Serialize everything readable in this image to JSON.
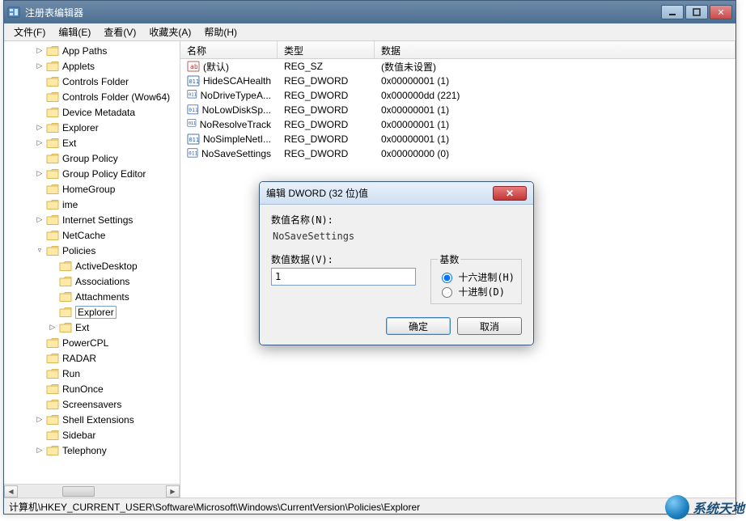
{
  "window": {
    "title": "注册表编辑器"
  },
  "menu": {
    "file": "文件(F)",
    "edit": "编辑(E)",
    "view": "查看(V)",
    "favorites": "收藏夹(A)",
    "help": "帮助(H)"
  },
  "tree": {
    "items": [
      {
        "exp": "▷",
        "label": "App Paths",
        "indent": 2
      },
      {
        "exp": "▷",
        "label": "Applets",
        "indent": 2
      },
      {
        "exp": "",
        "label": "Controls Folder",
        "indent": 2
      },
      {
        "exp": "",
        "label": "Controls Folder (Wow64)",
        "indent": 2
      },
      {
        "exp": "",
        "label": "Device Metadata",
        "indent": 2
      },
      {
        "exp": "▷",
        "label": "Explorer",
        "indent": 2
      },
      {
        "exp": "▷",
        "label": "Ext",
        "indent": 2
      },
      {
        "exp": "",
        "label": "Group Policy",
        "indent": 2
      },
      {
        "exp": "▷",
        "label": "Group Policy Editor",
        "indent": 2
      },
      {
        "exp": "",
        "label": "HomeGroup",
        "indent": 2
      },
      {
        "exp": "",
        "label": "ime",
        "indent": 2
      },
      {
        "exp": "▷",
        "label": "Internet Settings",
        "indent": 2
      },
      {
        "exp": "",
        "label": "NetCache",
        "indent": 2
      },
      {
        "exp": "▿",
        "label": "Policies",
        "indent": 2
      },
      {
        "exp": "",
        "label": "ActiveDesktop",
        "indent": 3
      },
      {
        "exp": "",
        "label": "Associations",
        "indent": 3
      },
      {
        "exp": "",
        "label": "Attachments",
        "indent": 3
      },
      {
        "exp": "",
        "label": "Explorer",
        "indent": 3,
        "selected": true
      },
      {
        "exp": "▷",
        "label": "Ext",
        "indent": 3
      },
      {
        "exp": "",
        "label": "PowerCPL",
        "indent": 2
      },
      {
        "exp": "",
        "label": "RADAR",
        "indent": 2
      },
      {
        "exp": "",
        "label": "Run",
        "indent": 2
      },
      {
        "exp": "",
        "label": "RunOnce",
        "indent": 2
      },
      {
        "exp": "",
        "label": "Screensavers",
        "indent": 2
      },
      {
        "exp": "▷",
        "label": "Shell Extensions",
        "indent": 2
      },
      {
        "exp": "",
        "label": "Sidebar",
        "indent": 2
      },
      {
        "exp": "▷",
        "label": "Telephony",
        "indent": 2
      }
    ]
  },
  "list": {
    "headers": {
      "name": "名称",
      "type": "类型",
      "data": "数据"
    },
    "rows": [
      {
        "icon": "sz",
        "name": "(默认)",
        "type": "REG_SZ",
        "data": "(数值未设置)"
      },
      {
        "icon": "dw",
        "name": "HideSCAHealth",
        "type": "REG_DWORD",
        "data": "0x00000001 (1)"
      },
      {
        "icon": "dw",
        "name": "NoDriveTypeA...",
        "type": "REG_DWORD",
        "data": "0x000000dd (221)"
      },
      {
        "icon": "dw",
        "name": "NoLowDiskSp...",
        "type": "REG_DWORD",
        "data": "0x00000001 (1)"
      },
      {
        "icon": "dw",
        "name": "NoResolveTrack",
        "type": "REG_DWORD",
        "data": "0x00000001 (1)"
      },
      {
        "icon": "dw",
        "name": "NoSimpleNetI...",
        "type": "REG_DWORD",
        "data": "0x00000001 (1)"
      },
      {
        "icon": "dw",
        "name": "NoSaveSettings",
        "type": "REG_DWORD",
        "data": "0x00000000 (0)"
      }
    ]
  },
  "statusbar": {
    "path": "计算机\\HKEY_CURRENT_USER\\Software\\Microsoft\\Windows\\CurrentVersion\\Policies\\Explorer"
  },
  "dialog": {
    "title": "编辑 DWORD (32 位)值",
    "name_label": "数值名称(N):",
    "name_value": "NoSaveSettings",
    "data_label": "数值数据(V):",
    "data_value": "1",
    "base_legend": "基数",
    "hex_label": "十六进制(H)",
    "dec_label": "十进制(D)",
    "ok": "确定",
    "cancel": "取消"
  },
  "watermark": {
    "text": "系统天地"
  }
}
